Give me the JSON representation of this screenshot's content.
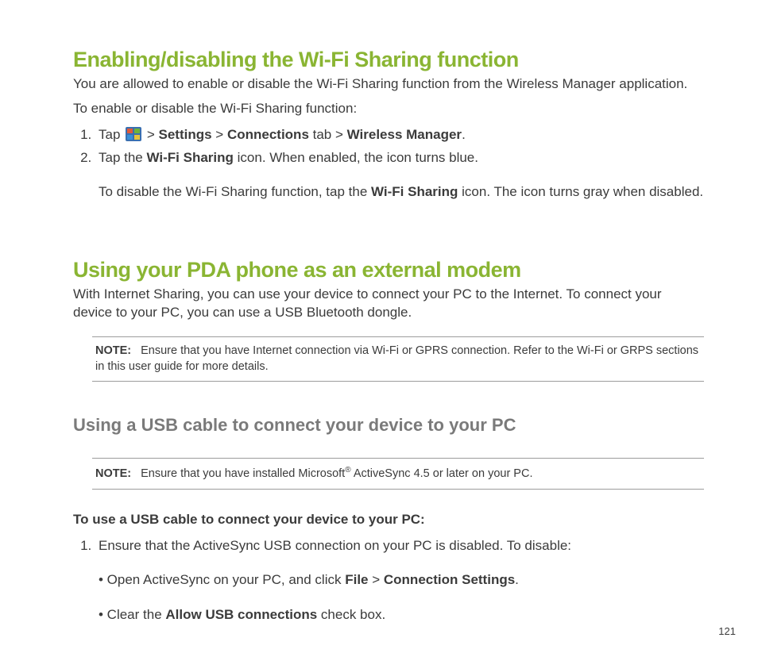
{
  "section1": {
    "title": "Enabling/disabling the Wi-Fi Sharing function",
    "intro": "You are allowed to enable or disable the Wi-Fi Sharing function from the Wireless Manager application.",
    "lead": "To enable or disable the Wi-Fi Sharing function:",
    "step1_pre": "Tap ",
    "step1_seg1": " > ",
    "step1_bold1": "Settings",
    "step1_seg2": " > ",
    "step1_bold2": "Connections",
    "step1_seg3": " tab > ",
    "step1_bold3": "Wireless Manager",
    "step1_end": ".",
    "step2_pre": "Tap the ",
    "step2_bold1": "Wi-Fi Sharing",
    "step2_post": " icon. When enabled, the icon turns blue.",
    "step2_line2_pre": "To disable the Wi-Fi Sharing function, tap the ",
    "step2_line2_bold": "Wi-Fi Sharing",
    "step2_line2_post": " icon. The icon turns gray when disabled."
  },
  "section2": {
    "title": "Using your PDA phone as an external modem",
    "intro": "With Internet Sharing, you can use your device to connect your PC to the Internet. To connect your device to your PC, you can use a USB Bluetooth dongle.",
    "note_label": "NOTE:",
    "note_text": "Ensure that you have Internet connection via Wi-Fi or GPRS connection. Refer to the Wi-Fi or GRPS sections in this user guide for more details."
  },
  "section3": {
    "heading": "Using a USB cable to connect your device to your PC",
    "note_label": "NOTE:",
    "note_pre": "Ensure that you have installed Microsoft",
    "note_sup": "®",
    "note_post": " ActiveSync 4.5 or later on your PC.",
    "lead": "To use a USB cable to connect your device to your PC:",
    "step1": "Ensure that the ActiveSync USB connection on your PC is disabled. To disable:",
    "bullet1_pre": "• Open ActiveSync on your PC, and click ",
    "bullet1_bold1": "File",
    "bullet1_mid": " > ",
    "bullet1_bold2": "Connection Settings",
    "bullet1_end": ".",
    "bullet2_pre": "• Clear the ",
    "bullet2_bold": "Allow USB connections",
    "bullet2_post": " check box."
  },
  "page_number": "121"
}
